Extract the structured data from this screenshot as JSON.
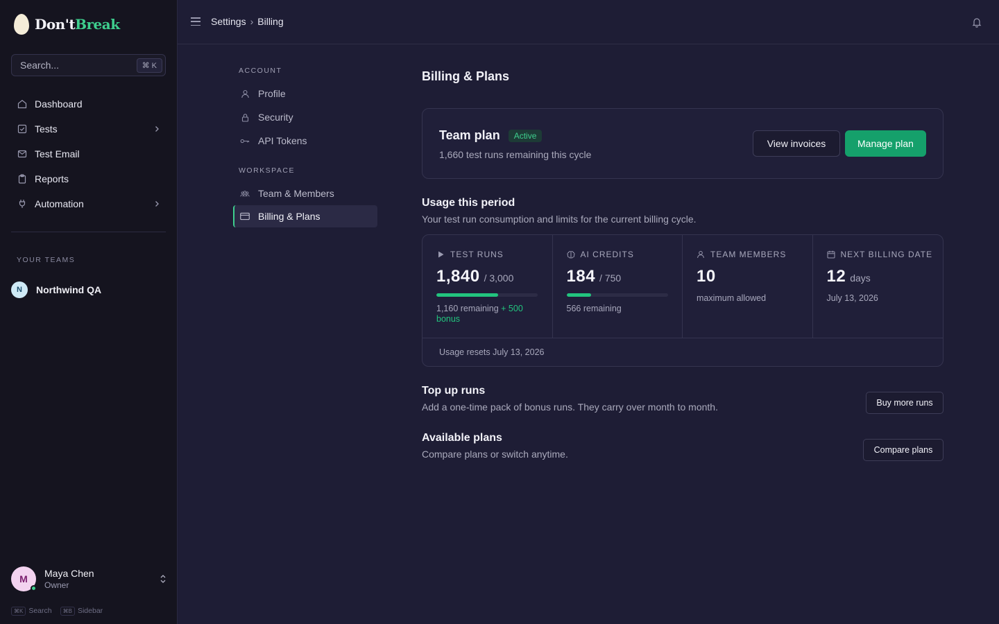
{
  "brand": {
    "name_part1": "Don't",
    "name_part2": "Break"
  },
  "search": {
    "placeholder": "Search...",
    "shortcut": "⌘ K"
  },
  "nav": {
    "items": [
      {
        "label": "Dashboard",
        "icon": "home-icon",
        "has_children": false
      },
      {
        "label": "Tests",
        "icon": "checkbox-icon",
        "has_children": true
      },
      {
        "label": "Test Email",
        "icon": "mail-icon",
        "has_children": false
      },
      {
        "label": "Reports",
        "icon": "clipboard-icon",
        "has_children": false
      },
      {
        "label": "Automation",
        "icon": "plug-icon",
        "has_children": true
      }
    ]
  },
  "teams": {
    "heading": "YOUR TEAMS",
    "items": [
      {
        "initial": "N",
        "name": "Northwind QA"
      }
    ]
  },
  "user": {
    "initial": "M",
    "name": "Maya Chen",
    "role": "Owner",
    "status_color": "#3ecf8e"
  },
  "shortcuts": [
    {
      "key": "⌘K",
      "label": "Search"
    },
    {
      "key": "⌘B",
      "label": "Sidebar"
    }
  ],
  "breadcrumb": {
    "parent": "Settings",
    "separator": "›",
    "current": "Billing"
  },
  "settings_nav": {
    "account_heading": "ACCOUNT",
    "account_items": [
      {
        "label": "Profile",
        "icon": "user-icon"
      },
      {
        "label": "Security",
        "icon": "lock-icon"
      },
      {
        "label": "API Tokens",
        "icon": "key-icon"
      }
    ],
    "workspace_heading": "WORKSPACE",
    "workspace_items": [
      {
        "label": "Team & Members",
        "icon": "users-icon"
      },
      {
        "label": "Billing & Plans",
        "icon": "credit-card-icon",
        "active": true
      }
    ]
  },
  "page": {
    "title": "Billing & Plans"
  },
  "plan": {
    "name": "Team plan",
    "status": "Active",
    "remaining_text": "1,660 test runs remaining this cycle",
    "view_invoices_label": "View invoices",
    "manage_plan_label": "Manage plan"
  },
  "usage": {
    "title": "Usage this period",
    "subtitle": "Your test run consumption and limits for the current billing cycle.",
    "test_runs": {
      "heading": "TEST RUNS",
      "value": "1,840",
      "limit": "/ 3,000",
      "progress": 0.613,
      "remaining": "1,160 remaining",
      "bonus": "+ 500 bonus"
    },
    "ai_credits": {
      "heading": "AI CREDITS",
      "value": "184",
      "limit": "/ 750",
      "progress": 0.245,
      "remaining": "566 remaining"
    },
    "team_members": {
      "heading": "TEAM MEMBERS",
      "value": "10",
      "note": "maximum allowed"
    },
    "next_billing": {
      "heading": "NEXT BILLING DATE",
      "value": "12",
      "unit": "days",
      "date": "July 13, 2026"
    },
    "resets": "Usage resets July 13, 2026"
  },
  "topup": {
    "title": "Top up runs",
    "subtitle": "Add a one-time pack of bonus runs. They carry over month to month.",
    "button": "Buy more runs"
  },
  "plans": {
    "title": "Available plans",
    "subtitle": "Compare plans or switch anytime.",
    "button": "Compare plans"
  },
  "colors": {
    "accent": "#3ecf8e",
    "primary_button": "#15a06b",
    "sidebar_bg": "#15141f",
    "main_bg": "#1e1d35"
  }
}
